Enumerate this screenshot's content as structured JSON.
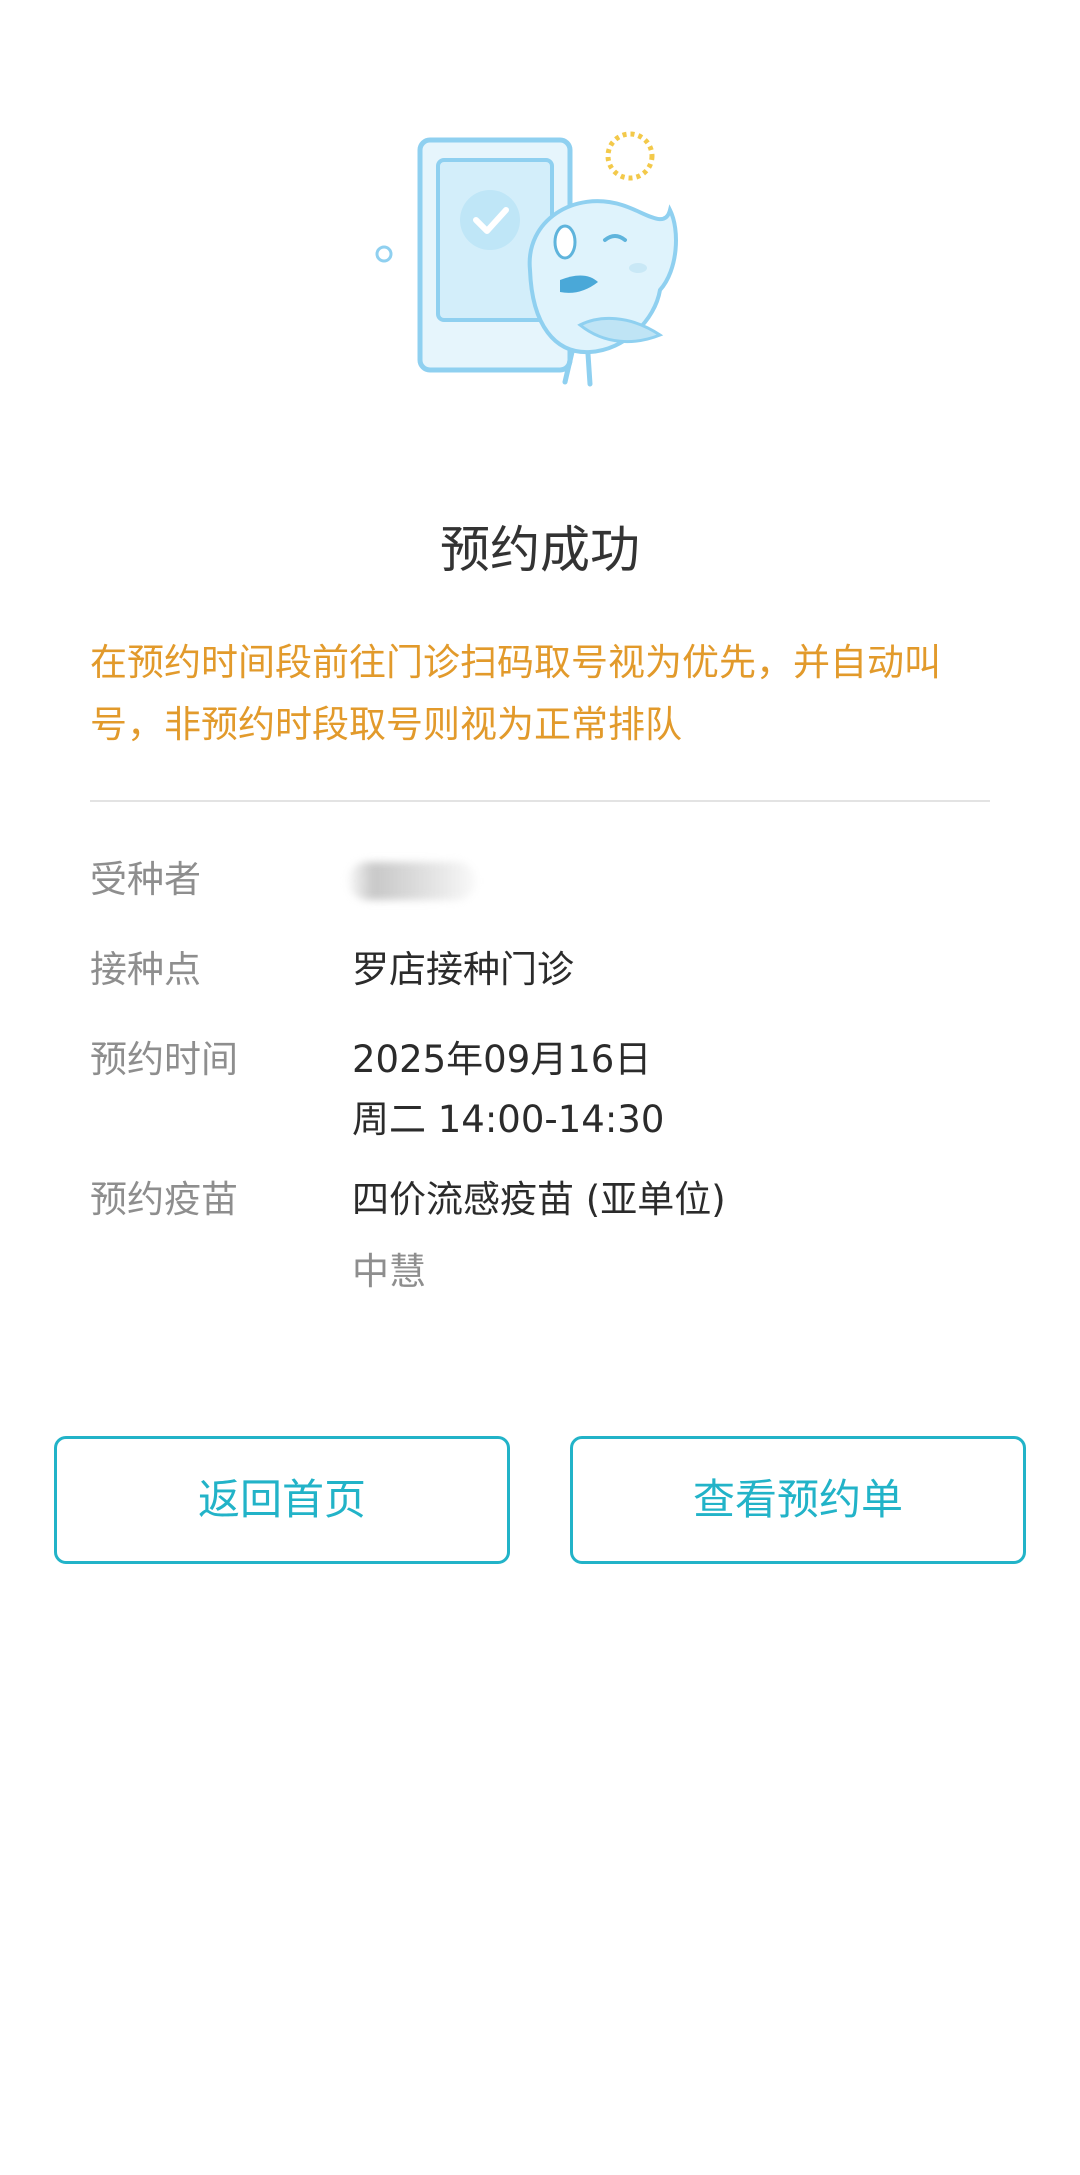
{
  "status": {
    "title": "预约成功",
    "notice": "在预约时间段前往门诊扫码取号视为优先，并自动叫号，非预约时段取号则视为正常排队"
  },
  "details": {
    "recipient": {
      "label": "受种者"
    },
    "site": {
      "label": "接种点",
      "value": "罗店接种门诊"
    },
    "time": {
      "label": "预约时间",
      "date": "2025年09月16日",
      "slot": "周二 14:00-14:30"
    },
    "vaccine": {
      "label": "预约疫苗",
      "name": "四价流感疫苗 (亚单位)",
      "maker": "中慧"
    }
  },
  "actions": {
    "home": "返回首页",
    "view_order": "查看预约单"
  },
  "colors": {
    "accent": "#22b3c8",
    "notice": "#e29a2b",
    "illustration": "#8fd0f0"
  }
}
